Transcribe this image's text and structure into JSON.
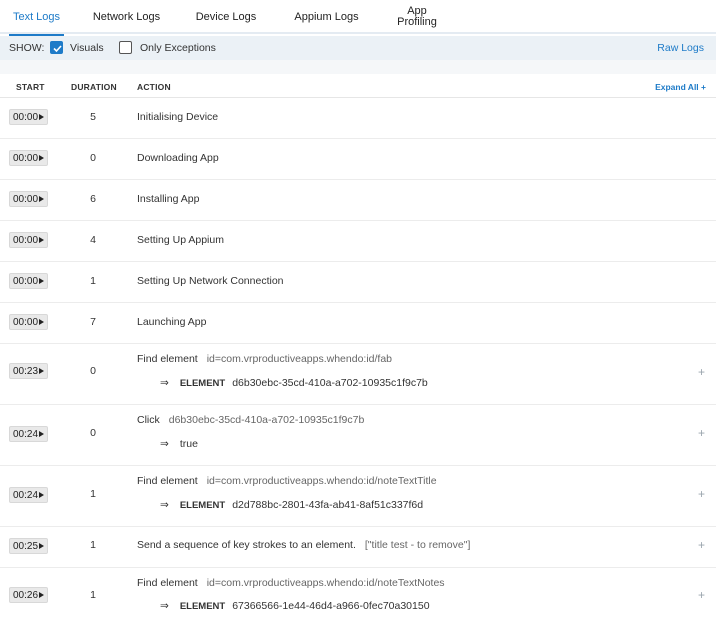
{
  "tabs": [
    {
      "label": "Text Logs",
      "active": true
    },
    {
      "label": "Network Logs",
      "active": false
    },
    {
      "label": "Device Logs",
      "active": false
    },
    {
      "label": "Appium Logs",
      "active": false
    },
    {
      "label_line1": "App",
      "label_line2": "Profiling",
      "active": false
    }
  ],
  "filter": {
    "show_label": "SHOW:",
    "visuals_label": "Visuals",
    "visuals_checked": true,
    "exceptions_label": "Only Exceptions",
    "exceptions_checked": false,
    "raw_logs": "Raw Logs"
  },
  "table": {
    "headers": {
      "start": "START",
      "duration": "DURATION",
      "action": "ACTION"
    },
    "expand_all": "Expand All +",
    "rows": [
      {
        "start": "00:00",
        "duration": "5",
        "action": "Initialising Device"
      },
      {
        "start": "00:00",
        "duration": "0",
        "action": "Downloading App"
      },
      {
        "start": "00:00",
        "duration": "6",
        "action": "Installing App"
      },
      {
        "start": "00:00",
        "duration": "4",
        "action": "Setting Up Appium"
      },
      {
        "start": "00:00",
        "duration": "1",
        "action": "Setting Up Network Connection"
      },
      {
        "start": "00:00",
        "duration": "7",
        "action": "Launching App"
      },
      {
        "start": "00:23",
        "duration": "0",
        "action": "Find element",
        "param": "id=com.vrproductiveapps.whendo:id/fab",
        "result_arrow": "⇒",
        "result_kw": "ELEMENT",
        "result_val": "d6b30ebc-35cd-410a-a702-10935c1f9c7b",
        "expand": "+"
      },
      {
        "start": "00:24",
        "duration": "0",
        "action": "Click",
        "param": "d6b30ebc-35cd-410a-a702-10935c1f9c7b",
        "result_arrow": "⇒",
        "result_kw": "",
        "result_val": "true",
        "expand": "+"
      },
      {
        "start": "00:24",
        "duration": "1",
        "action": "Find element",
        "param": "id=com.vrproductiveapps.whendo:id/noteTextTitle",
        "result_arrow": "⇒",
        "result_kw": "ELEMENT",
        "result_val": "d2d788bc-2801-43fa-ab41-8af51c337f6d",
        "expand": "+"
      },
      {
        "start": "00:25",
        "duration": "1",
        "action": "Send a sequence of key strokes to an element.",
        "param": "[\"title test - to remove\"]",
        "expand": "+"
      },
      {
        "start": "00:26",
        "duration": "1",
        "action": "Find element",
        "param": "id=com.vrproductiveapps.whendo:id/noteTextNotes",
        "result_arrow": "⇒",
        "result_kw": "ELEMENT",
        "result_val": "67366566-1e44-46d4-a966-0fec70a30150",
        "expand": "+"
      }
    ]
  },
  "colors": {
    "accent": "#1e7bc8",
    "filter_bg": "#ebf1f6"
  },
  "icons": {
    "checkbox_checked": "check-icon",
    "start_arrow": "play-arrow-icon",
    "expand": "plus-icon"
  }
}
